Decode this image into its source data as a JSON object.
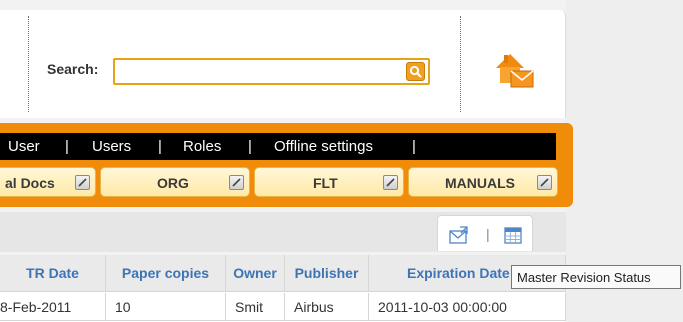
{
  "header": {
    "search_label": "Search:",
    "search_value": "",
    "search_button_icon": "search-icon",
    "home_mail_icon": "home-mail-icon"
  },
  "menu": {
    "items": [
      "User",
      "Users",
      "Roles",
      "Offline settings"
    ]
  },
  "tabs": [
    {
      "label": "al Docs"
    },
    {
      "label": "ORG"
    },
    {
      "label": "FLT"
    },
    {
      "label": "MANUALS"
    }
  ],
  "toolbar": {
    "buttons": [
      "email-icon",
      "calendar-icon"
    ],
    "separator": "|"
  },
  "table": {
    "columns": [
      "TR Date",
      "Paper copies",
      "Owner",
      "Publisher",
      "Expiration Date"
    ],
    "rows": [
      [
        "8-Feb-2011",
        "10",
        "Smit",
        "Airbus",
        "2011-10-03 00:00:00"
      ]
    ]
  },
  "tooltip": "Master Revision Status",
  "colors": {
    "accent_orange": "#f08c0a",
    "header_link_blue": "#3d74b6",
    "menu_black": "#000000"
  }
}
